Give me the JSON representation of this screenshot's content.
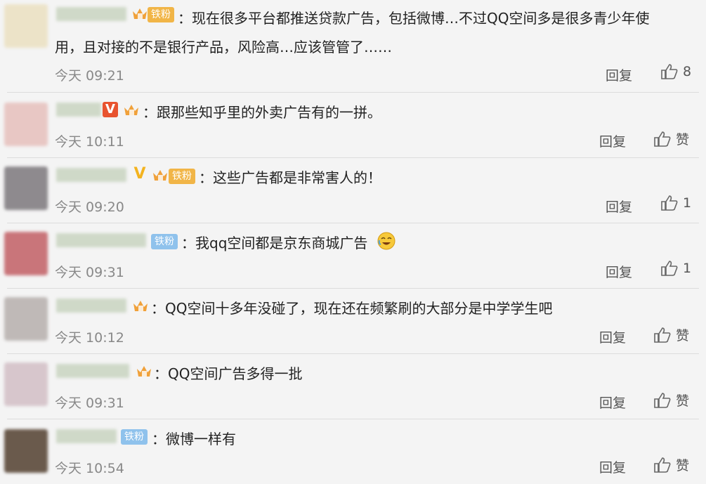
{
  "comments": [
    {
      "text": "：现在很多平台都推送贷款广告，包括微博…不过QQ空间多是很多青少年使",
      "text2": "用，且对接的不是银行产品，风险高…应该管管了……",
      "time": "今天 09:21",
      "reply": "回复",
      "like": "8",
      "fan": "铁粉",
      "avatar": "#ece3c8"
    },
    {
      "text": "：跟那些知乎里的外卖广告有的一拼。",
      "time": "今天 10:11",
      "reply": "回复",
      "like": "赞",
      "v": "V",
      "avatar": "#e8c7c4"
    },
    {
      "text": "：这些广告都是非常害人的！",
      "time": "今天 09:20",
      "reply": "回复",
      "like": "1",
      "fan": "铁粉",
      "v": "V",
      "avatar": "#8e8a8e"
    },
    {
      "text": "：我qq空间都是京东商城广告",
      "time": "今天 09:31",
      "reply": "回复",
      "like": "1",
      "fan": "铁粉",
      "avatar": "#c9757a"
    },
    {
      "text": "：QQ空间十多年没碰了，现在还在频繁刷的大部分是中学学生吧",
      "time": "今天 10:12",
      "reply": "回复",
      "like": "赞",
      "avatar": "#bfb9b7"
    },
    {
      "text": "：QQ空间广告多得一批",
      "time": "今天 09:31",
      "reply": "回复",
      "like": "赞",
      "avatar": "#d7c6cc"
    },
    {
      "text": "：微博一样有",
      "time": "今天 10:54",
      "reply": "回复",
      "like": "赞",
      "fan": "铁粉",
      "avatar": "#6a5a4c"
    }
  ],
  "colors": {
    "background": "#f4f4f4",
    "fan_gold": "#f1b547",
    "fan_blue": "#8fc2ec",
    "v_red": "#e8532f",
    "v_gold": "#f3b31f"
  },
  "icons": [
    "thumb-up-icon",
    "crown-fan-icon",
    "laugh-cry-emoji-icon"
  ]
}
